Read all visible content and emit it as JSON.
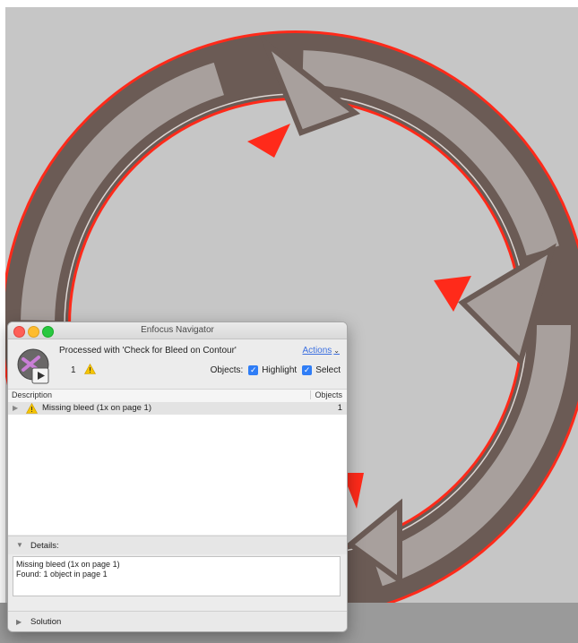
{
  "window": {
    "title": "Enfocus Navigator"
  },
  "header": {
    "processed_text": "Processed with 'Check for Bleed on Contour'",
    "actions_label": "Actions",
    "issue_count": "1",
    "objects_label": "Objects:",
    "highlight_label": "Highlight",
    "highlight_checked": true,
    "select_label": "Select",
    "select_checked": true
  },
  "columns": {
    "description": "Description",
    "objects": "Objects"
  },
  "results": [
    {
      "label": "Missing bleed  (1x on page 1)",
      "count": "1",
      "severity": "warning"
    }
  ],
  "details": {
    "label": "Details:",
    "line1": "Missing bleed  (1x on page 1)",
    "line2": "Found: 1 object in page 1"
  },
  "solution": {
    "label": "Solution"
  },
  "colors": {
    "canvas": "#c6c6c6",
    "arrow_dark": "#6b5b55",
    "arrow_light": "#a8a09d",
    "bleed_highlight": "#ff2a1a",
    "accent_blue": "#2f7df6",
    "warning_yellow": "#f5c400"
  },
  "icons": [
    "close-button",
    "minimize-button",
    "maximize-button",
    "navigator-logo-icon",
    "warning-icon",
    "chevron-down-icon",
    "disclosure-triangle-icon",
    "checkmark-icon"
  ]
}
